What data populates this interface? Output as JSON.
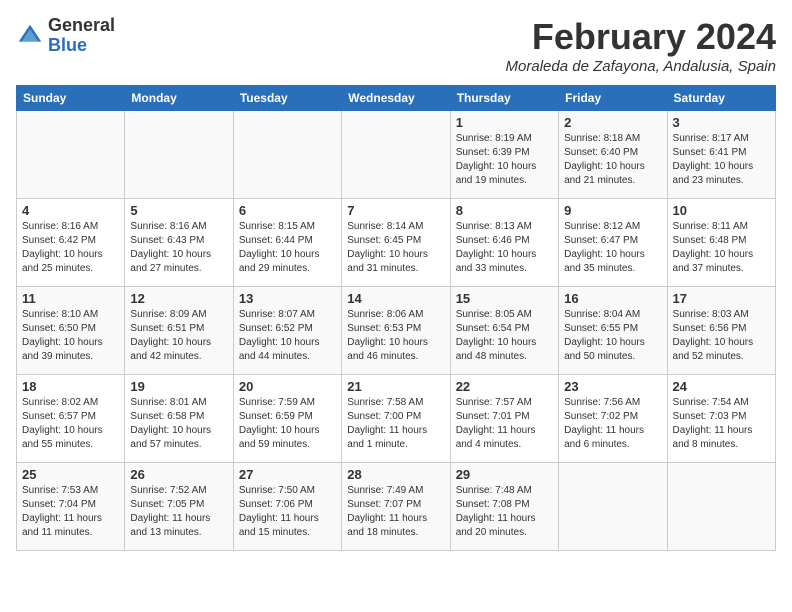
{
  "header": {
    "logo_general": "General",
    "logo_blue": "Blue",
    "month_title": "February 2024",
    "location": "Moraleda de Zafayona, Andalusia, Spain"
  },
  "weekdays": [
    "Sunday",
    "Monday",
    "Tuesday",
    "Wednesday",
    "Thursday",
    "Friday",
    "Saturday"
  ],
  "weeks": [
    [
      {
        "day": "",
        "info": ""
      },
      {
        "day": "",
        "info": ""
      },
      {
        "day": "",
        "info": ""
      },
      {
        "day": "",
        "info": ""
      },
      {
        "day": "1",
        "info": "Sunrise: 8:19 AM\nSunset: 6:39 PM\nDaylight: 10 hours\nand 19 minutes."
      },
      {
        "day": "2",
        "info": "Sunrise: 8:18 AM\nSunset: 6:40 PM\nDaylight: 10 hours\nand 21 minutes."
      },
      {
        "day": "3",
        "info": "Sunrise: 8:17 AM\nSunset: 6:41 PM\nDaylight: 10 hours\nand 23 minutes."
      }
    ],
    [
      {
        "day": "4",
        "info": "Sunrise: 8:16 AM\nSunset: 6:42 PM\nDaylight: 10 hours\nand 25 minutes."
      },
      {
        "day": "5",
        "info": "Sunrise: 8:16 AM\nSunset: 6:43 PM\nDaylight: 10 hours\nand 27 minutes."
      },
      {
        "day": "6",
        "info": "Sunrise: 8:15 AM\nSunset: 6:44 PM\nDaylight: 10 hours\nand 29 minutes."
      },
      {
        "day": "7",
        "info": "Sunrise: 8:14 AM\nSunset: 6:45 PM\nDaylight: 10 hours\nand 31 minutes."
      },
      {
        "day": "8",
        "info": "Sunrise: 8:13 AM\nSunset: 6:46 PM\nDaylight: 10 hours\nand 33 minutes."
      },
      {
        "day": "9",
        "info": "Sunrise: 8:12 AM\nSunset: 6:47 PM\nDaylight: 10 hours\nand 35 minutes."
      },
      {
        "day": "10",
        "info": "Sunrise: 8:11 AM\nSunset: 6:48 PM\nDaylight: 10 hours\nand 37 minutes."
      }
    ],
    [
      {
        "day": "11",
        "info": "Sunrise: 8:10 AM\nSunset: 6:50 PM\nDaylight: 10 hours\nand 39 minutes."
      },
      {
        "day": "12",
        "info": "Sunrise: 8:09 AM\nSunset: 6:51 PM\nDaylight: 10 hours\nand 42 minutes."
      },
      {
        "day": "13",
        "info": "Sunrise: 8:07 AM\nSunset: 6:52 PM\nDaylight: 10 hours\nand 44 minutes."
      },
      {
        "day": "14",
        "info": "Sunrise: 8:06 AM\nSunset: 6:53 PM\nDaylight: 10 hours\nand 46 minutes."
      },
      {
        "day": "15",
        "info": "Sunrise: 8:05 AM\nSunset: 6:54 PM\nDaylight: 10 hours\nand 48 minutes."
      },
      {
        "day": "16",
        "info": "Sunrise: 8:04 AM\nSunset: 6:55 PM\nDaylight: 10 hours\nand 50 minutes."
      },
      {
        "day": "17",
        "info": "Sunrise: 8:03 AM\nSunset: 6:56 PM\nDaylight: 10 hours\nand 52 minutes."
      }
    ],
    [
      {
        "day": "18",
        "info": "Sunrise: 8:02 AM\nSunset: 6:57 PM\nDaylight: 10 hours\nand 55 minutes."
      },
      {
        "day": "19",
        "info": "Sunrise: 8:01 AM\nSunset: 6:58 PM\nDaylight: 10 hours\nand 57 minutes."
      },
      {
        "day": "20",
        "info": "Sunrise: 7:59 AM\nSunset: 6:59 PM\nDaylight: 10 hours\nand 59 minutes."
      },
      {
        "day": "21",
        "info": "Sunrise: 7:58 AM\nSunset: 7:00 PM\nDaylight: 11 hours\nand 1 minute."
      },
      {
        "day": "22",
        "info": "Sunrise: 7:57 AM\nSunset: 7:01 PM\nDaylight: 11 hours\nand 4 minutes."
      },
      {
        "day": "23",
        "info": "Sunrise: 7:56 AM\nSunset: 7:02 PM\nDaylight: 11 hours\nand 6 minutes."
      },
      {
        "day": "24",
        "info": "Sunrise: 7:54 AM\nSunset: 7:03 PM\nDaylight: 11 hours\nand 8 minutes."
      }
    ],
    [
      {
        "day": "25",
        "info": "Sunrise: 7:53 AM\nSunset: 7:04 PM\nDaylight: 11 hours\nand 11 minutes."
      },
      {
        "day": "26",
        "info": "Sunrise: 7:52 AM\nSunset: 7:05 PM\nDaylight: 11 hours\nand 13 minutes."
      },
      {
        "day": "27",
        "info": "Sunrise: 7:50 AM\nSunset: 7:06 PM\nDaylight: 11 hours\nand 15 minutes."
      },
      {
        "day": "28",
        "info": "Sunrise: 7:49 AM\nSunset: 7:07 PM\nDaylight: 11 hours\nand 18 minutes."
      },
      {
        "day": "29",
        "info": "Sunrise: 7:48 AM\nSunset: 7:08 PM\nDaylight: 11 hours\nand 20 minutes."
      },
      {
        "day": "",
        "info": ""
      },
      {
        "day": "",
        "info": ""
      }
    ]
  ]
}
